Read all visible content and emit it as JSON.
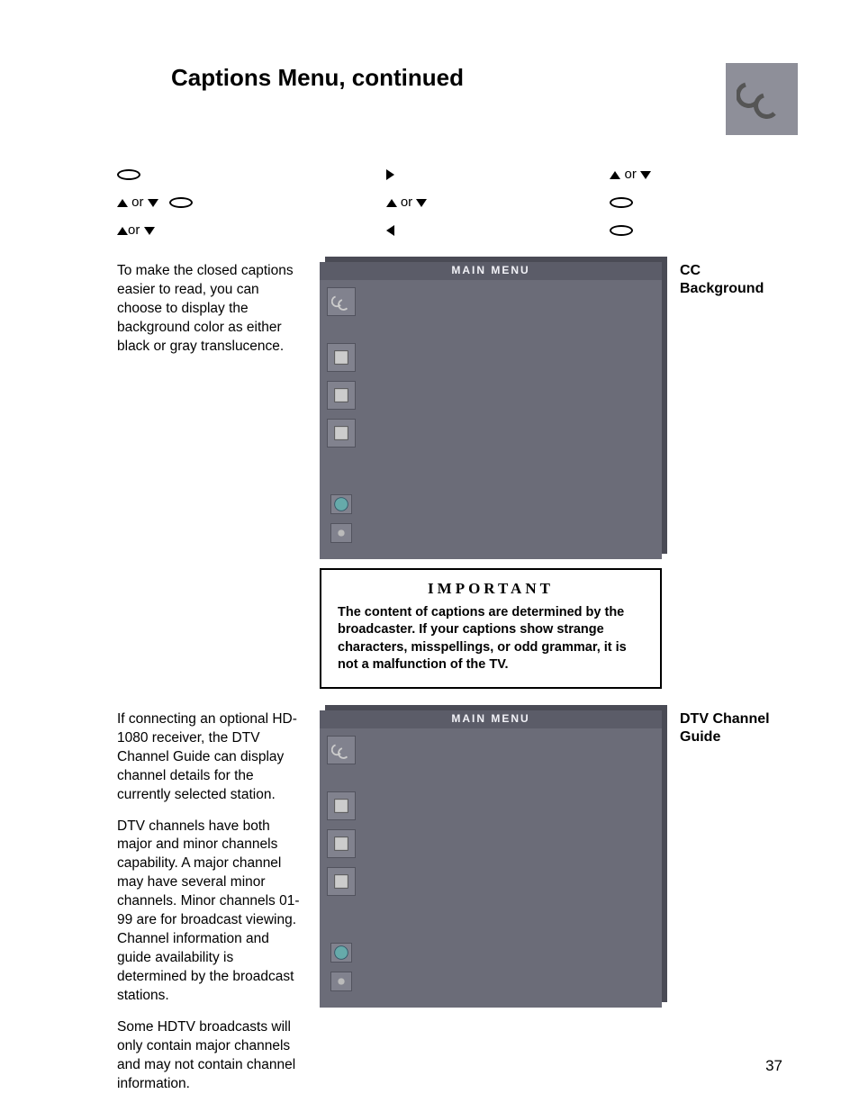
{
  "page_title": "Captions Menu, continued",
  "page_number": "37",
  "cc_icon": "cc-icon",
  "steps": {
    "col1_l1_a": " ",
    "col1_l2_a": " or ",
    "col1_l3_a": "or ",
    "col2_l1": " ",
    "col2_l2": " or ",
    "col2_l3": " ",
    "col3_l1": " or ",
    "col3_l2": " ",
    "col3_l3": " "
  },
  "section1": {
    "left_text": "To make the closed captions easier to read, you can choose to display the background color as either black or gray translucence.",
    "right_label_l1": "CC",
    "right_label_l2": "Background",
    "tv_header": "MAIN MENU"
  },
  "important": {
    "title": "IMPORTANT",
    "body": "The content of captions are determined by the broadcaster.  If your captions show strange characters, misspellings, or odd grammar, it is not a malfunction of the TV."
  },
  "section2": {
    "left_p1": "If connecting an optional HD-1080 receiver,  the DTV Channel Guide can display channel details for the currently selected station.",
    "left_p2": "DTV channels have both major and minor channels capability. A major channel may have several minor channels.  Minor channels 01-99 are for broadcast viewing.  Channel information and guide availability is determined by the broadcast stations.",
    "left_p3": "Some HDTV broadcasts will only contain major channels and may not contain channel information.",
    "right_label_l1": "DTV Channel",
    "right_label_l2": "Guide",
    "tv_header": "MAIN MENU"
  }
}
